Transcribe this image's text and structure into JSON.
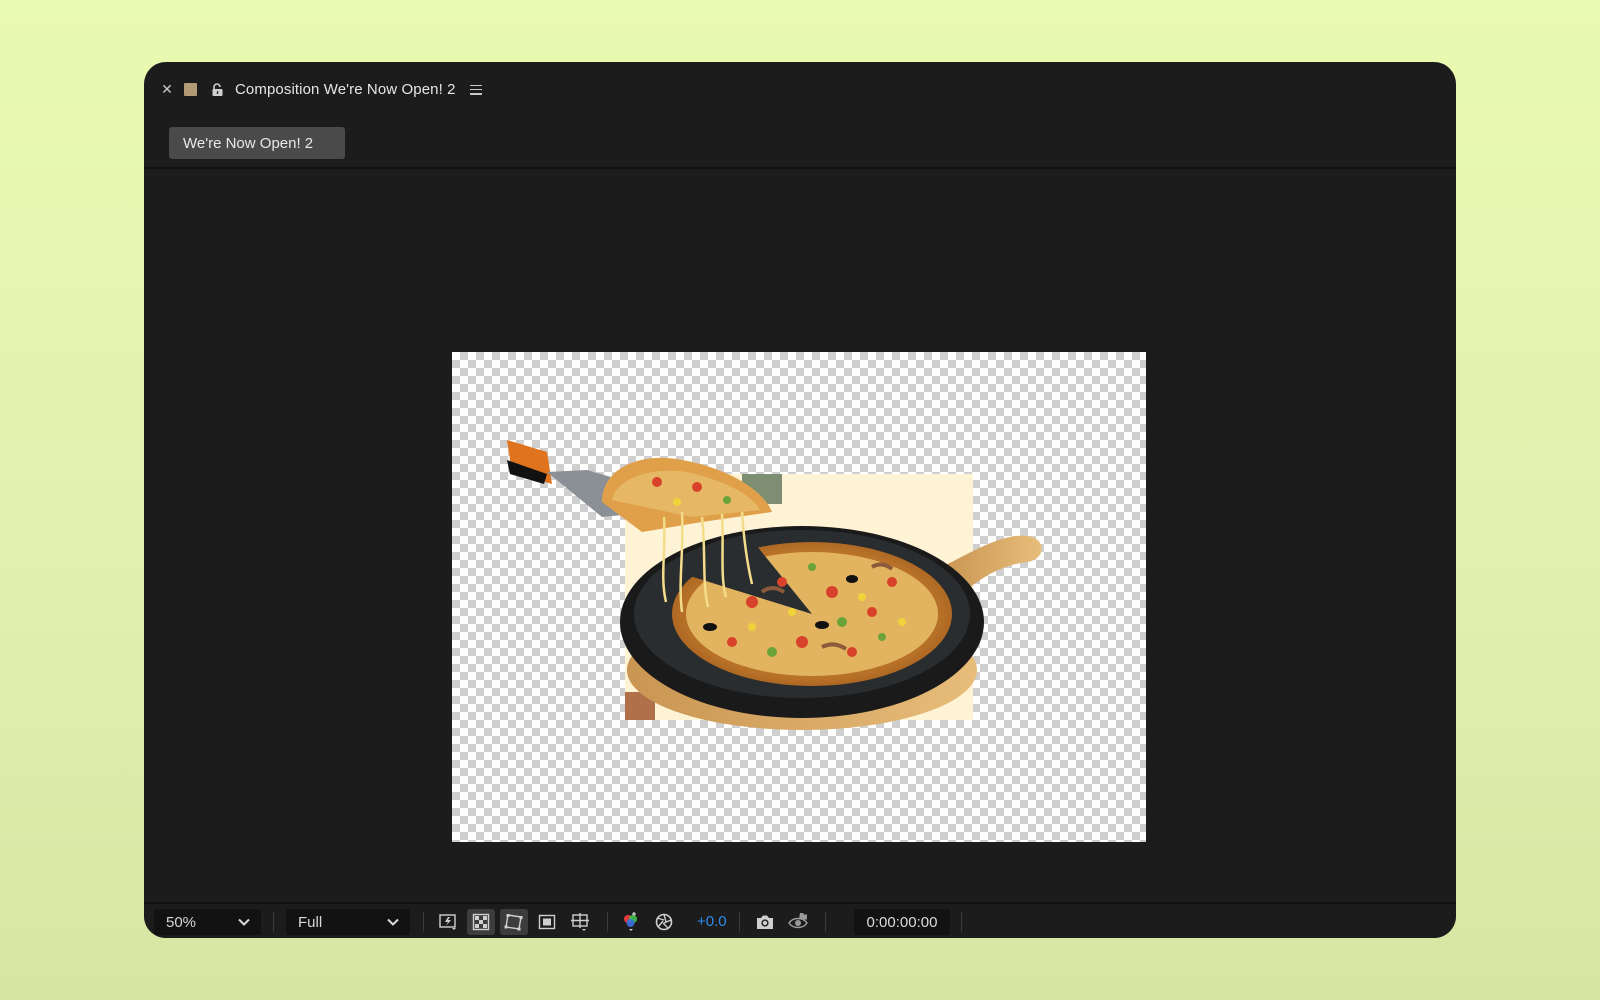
{
  "panel": {
    "title": "Composition We're Now Open! 2",
    "swatch_color": "#b49b78",
    "icons": [
      "close-icon",
      "lock-open-icon",
      "panel-menu-icon"
    ]
  },
  "tabs": [
    {
      "label": "We're Now Open! 2",
      "active": true
    }
  ],
  "viewer": {
    "background": "transparency-checkerboard",
    "content": "pizza-image"
  },
  "toolbar": {
    "magnification": "50%",
    "resolution": "Full",
    "exposure": "+0.0",
    "timecode": "0:00:00:00",
    "accent_color": "#2d8ceb",
    "icons": [
      "fast-previews-icon",
      "transparency-grid-icon",
      "mask-visibility-icon",
      "region-of-interest-icon",
      "grid-guides-icon",
      "channel-icon",
      "reset-exposure-icon",
      "snapshot-icon",
      "show-snapshot-icon"
    ]
  }
}
